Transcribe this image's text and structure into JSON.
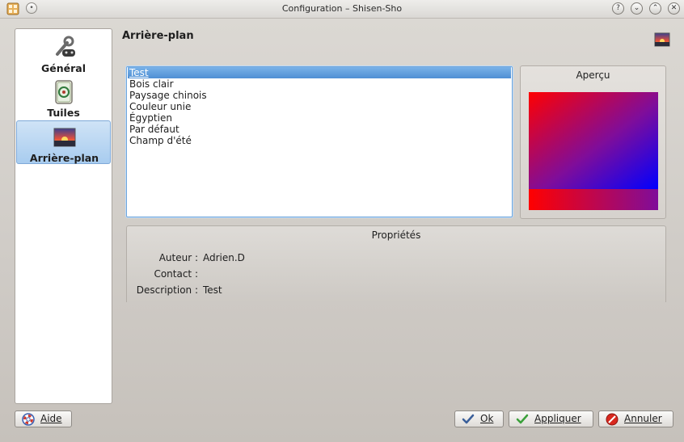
{
  "window": {
    "title": "Configuration – Shisen-Sho"
  },
  "sidebar": {
    "items": [
      {
        "label": "Général",
        "icon": "wrench-gamepad-icon"
      },
      {
        "label": "Tuiles",
        "icon": "mahjong-tile-icon"
      },
      {
        "label": "Arrière-plan",
        "icon": "sunset-image-icon",
        "selected": true
      }
    ]
  },
  "page": {
    "title": "Arrière-plan"
  },
  "backgrounds": {
    "items": [
      "Test",
      "Bois clair",
      "Paysage chinois",
      "Couleur unie",
      "Égyptien",
      "Par défaut",
      "Champ d'été"
    ],
    "selected_index": 0
  },
  "preview": {
    "title": "Aperçu"
  },
  "properties": {
    "title": "Propriétés",
    "author_label": "Auteur :",
    "author_value": "Adrien.D",
    "contact_label": "Contact :",
    "contact_value": "",
    "description_label": "Description :",
    "description_value": "Test"
  },
  "buttons": {
    "help": "Aide",
    "ok": "Ok",
    "apply": "Appliquer",
    "cancel": "Annuler"
  },
  "colors": {
    "selection": "#4f8fd4",
    "preview_red": "#ff0000",
    "preview_blue": "#0000ff",
    "preview_purple": "#7f0d9a"
  }
}
